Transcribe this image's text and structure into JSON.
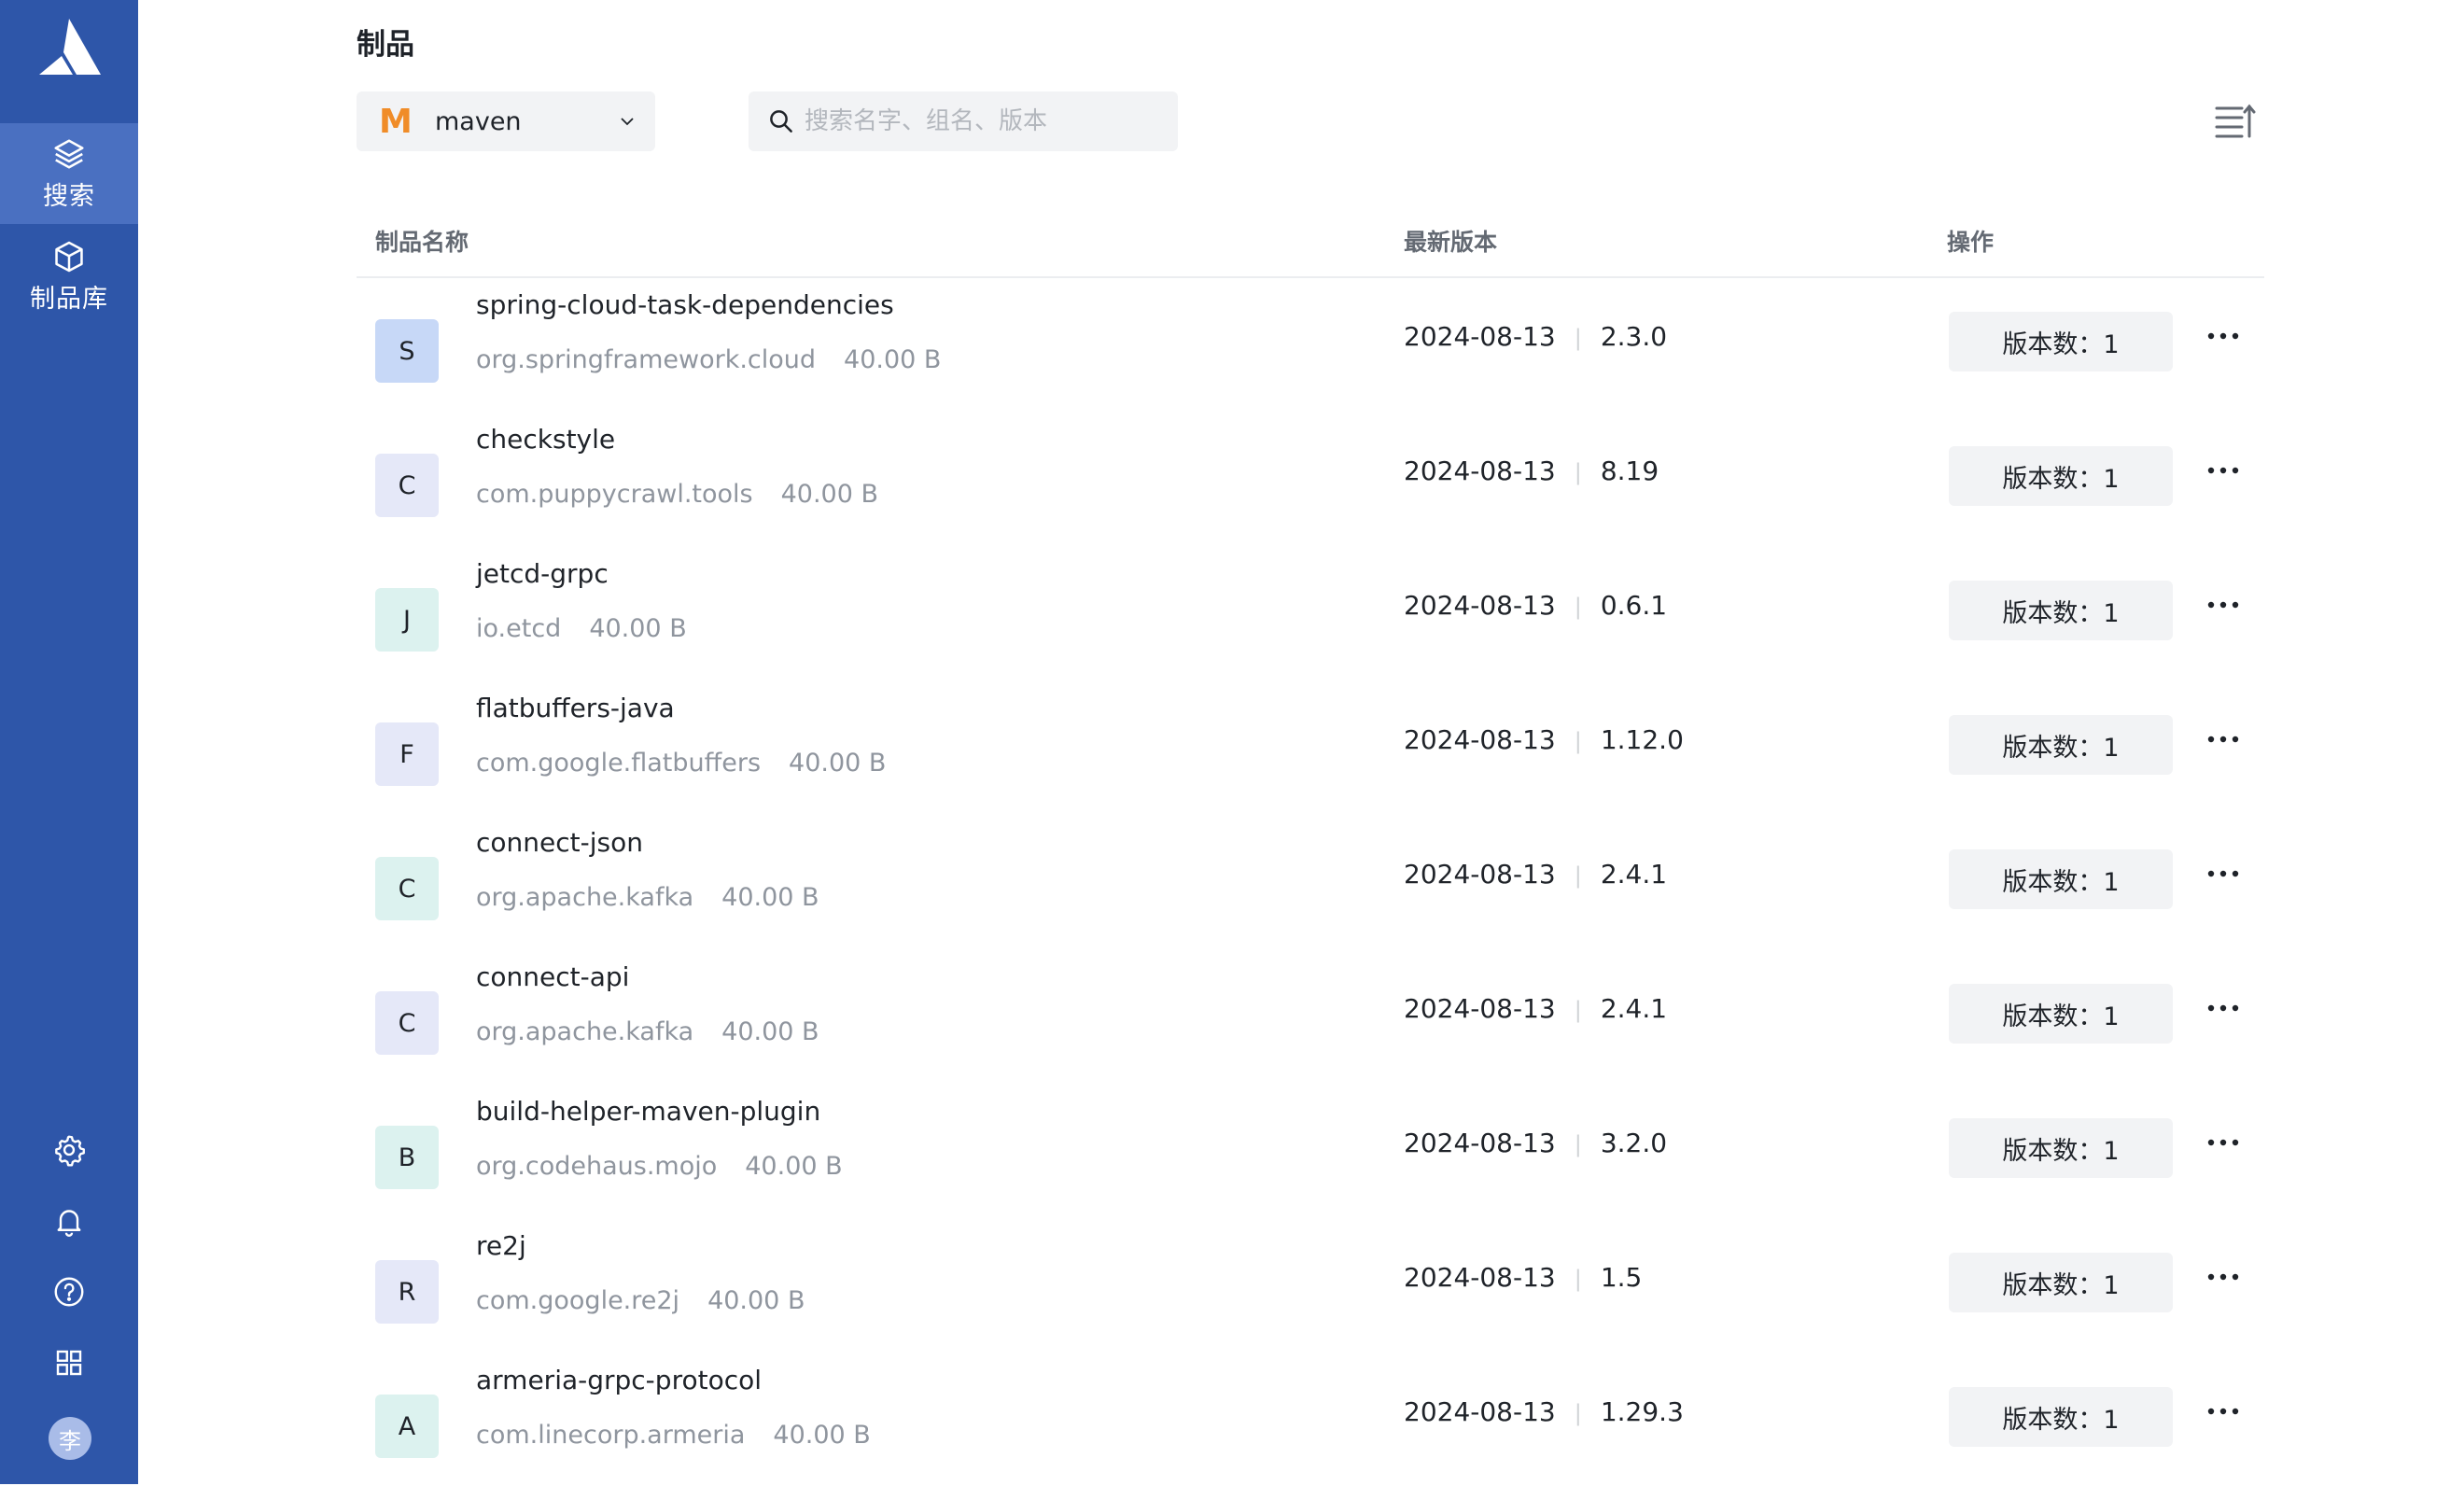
{
  "nav": {
    "items": [
      {
        "label": "搜索",
        "icon": "layers-icon",
        "active": true
      },
      {
        "label": "制品库",
        "icon": "box-icon",
        "active": false
      }
    ],
    "avatar_text": "李"
  },
  "page": {
    "title": "制品"
  },
  "repo_select": {
    "icon_letter": "M",
    "value": "maven"
  },
  "search": {
    "placeholder": "搜索名字、组名、版本"
  },
  "table": {
    "headers": {
      "name": "制品名称",
      "version": "最新版本",
      "actions": "操作"
    },
    "rows": [
      {
        "letter": "S",
        "name": "spring-cloud-task-dependencies",
        "group": "org.springframework.cloud",
        "size": "40.00 B",
        "date": "2024-08-13",
        "version": "2.3.0",
        "count": "版本数：1"
      },
      {
        "letter": "C",
        "name": "checkstyle",
        "group": "com.puppycrawl.tools",
        "size": "40.00 B",
        "date": "2024-08-13",
        "version": "8.19",
        "count": "版本数：1"
      },
      {
        "letter": "J",
        "name": "jetcd-grpc",
        "group": "io.etcd",
        "size": "40.00 B",
        "date": "2024-08-13",
        "version": "0.6.1",
        "count": "版本数：1"
      },
      {
        "letter": "F",
        "name": "flatbuffers-java",
        "group": "com.google.flatbuffers",
        "size": "40.00 B",
        "date": "2024-08-13",
        "version": "1.12.0",
        "count": "版本数：1"
      },
      {
        "letter": "C",
        "name": "connect-json",
        "group": "org.apache.kafka",
        "size": "40.00 B",
        "date": "2024-08-13",
        "version": "2.4.1",
        "count": "版本数：1"
      },
      {
        "letter": "C",
        "name": "connect-api",
        "group": "org.apache.kafka",
        "size": "40.00 B",
        "date": "2024-08-13",
        "version": "2.4.1",
        "count": "版本数：1"
      },
      {
        "letter": "B",
        "name": "build-helper-maven-plugin",
        "group": "org.codehaus.mojo",
        "size": "40.00 B",
        "date": "2024-08-13",
        "version": "3.2.0",
        "count": "版本数：1"
      },
      {
        "letter": "R",
        "name": "re2j",
        "group": "com.google.re2j",
        "size": "40.00 B",
        "date": "2024-08-13",
        "version": "1.5",
        "count": "版本数：1"
      },
      {
        "letter": "A",
        "name": "armeria-grpc-protocol",
        "group": "com.linecorp.armeria",
        "size": "40.00 B",
        "date": "2024-08-13",
        "version": "1.29.3",
        "count": "版本数：1"
      }
    ]
  },
  "colors": {
    "sidebar": "#2e56a9",
    "sidebar_active": "#4a70c1",
    "maven_orange": "#f08c28",
    "badge_blue": "#c7d8f7",
    "badge_lavender": "#e5e8f8",
    "badge_mint": "#dcf2ef"
  }
}
